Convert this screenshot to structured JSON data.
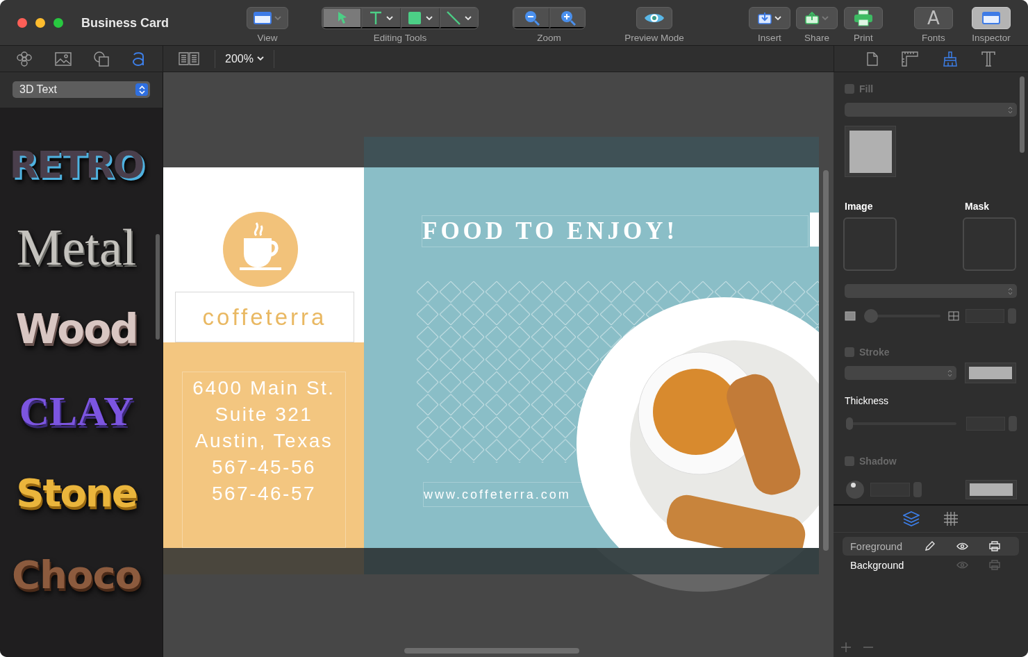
{
  "window": {
    "title": "Business Card"
  },
  "toolbar": [
    {
      "kind": "view",
      "label": "View",
      "selected": false
    },
    {
      "kind": "tools",
      "label": "Editing Tools",
      "segments": [
        {
          "selected": true
        },
        {
          "selected": false
        },
        {
          "selected": false
        },
        {
          "selected": false
        }
      ]
    },
    {
      "kind": "zoom",
      "label": "Zoom"
    },
    {
      "kind": "preview",
      "label": "Preview Mode",
      "selected": false
    },
    {
      "kind": "insert",
      "label": "Insert",
      "selected": false
    },
    {
      "kind": "share",
      "label": "Share",
      "selected": false
    },
    {
      "kind": "print",
      "label": "Print",
      "selected": false
    },
    {
      "kind": "fonts",
      "label": "Fonts",
      "glyph": "A",
      "selected": false
    },
    {
      "kind": "inspector",
      "label": "Inspector",
      "selected": true
    }
  ],
  "library_tabs": [
    {
      "kind": "flower",
      "selected": false
    },
    {
      "kind": "image",
      "selected": false
    },
    {
      "kind": "shapes",
      "selected": false
    },
    {
      "kind": "text",
      "selected": true
    }
  ],
  "style_popup": {
    "value": "3D Text"
  },
  "text_styles": [
    {
      "kind": "retro",
      "label": "RETRO",
      "color": "#4a3f4c"
    },
    {
      "kind": "metal",
      "label": "Metal",
      "color": "#c4c2bd"
    },
    {
      "kind": "wood",
      "label": "Wood",
      "color": "#d8c6c2"
    },
    {
      "kind": "clay",
      "label": "CLAY",
      "color": "#7c55e0"
    },
    {
      "kind": "stone",
      "label": "Stone",
      "color": "#eab53c"
    },
    {
      "kind": "choco",
      "label": "Choco",
      "color": "#8c5b3e"
    }
  ],
  "zoom_menu": {
    "value": "200%"
  },
  "card": {
    "headline": "FOOD TO ENJOY!",
    "brand": "coffeterra",
    "address_lines": [
      "6400 Main St.",
      "Suite 321",
      "Austin, Texas",
      "567-45-56",
      "567-46-57"
    ],
    "website": "www.coffeterra.com"
  },
  "inspector": {
    "tabs": [
      {
        "kind": "page",
        "selected": false
      },
      {
        "kind": "ruler",
        "selected": false
      },
      {
        "kind": "brush",
        "selected": true
      },
      {
        "kind": "text",
        "selected": false
      }
    ],
    "fill": {
      "label": "Fill",
      "checked": false,
      "disabled": true
    },
    "image_label": "Image",
    "mask_label": "Mask",
    "image_scale": {
      "level": 0
    },
    "stroke": {
      "label": "Stroke",
      "checked": false,
      "disabled": true
    },
    "thickness": {
      "label": "Thickness",
      "level": 0
    },
    "shadow": {
      "label": "Shadow",
      "checked": false,
      "disabled": true
    }
  },
  "layer_tabs": [
    {
      "kind": "layers",
      "selected": true
    },
    {
      "kind": "grid",
      "selected": false
    }
  ],
  "layers": [
    {
      "name": "Foreground",
      "selected": true,
      "editing": true
    },
    {
      "name": "Background",
      "selected": false,
      "editing": false
    }
  ],
  "layer_actions": [
    {
      "kind": "add"
    },
    {
      "kind": "remove"
    }
  ]
}
